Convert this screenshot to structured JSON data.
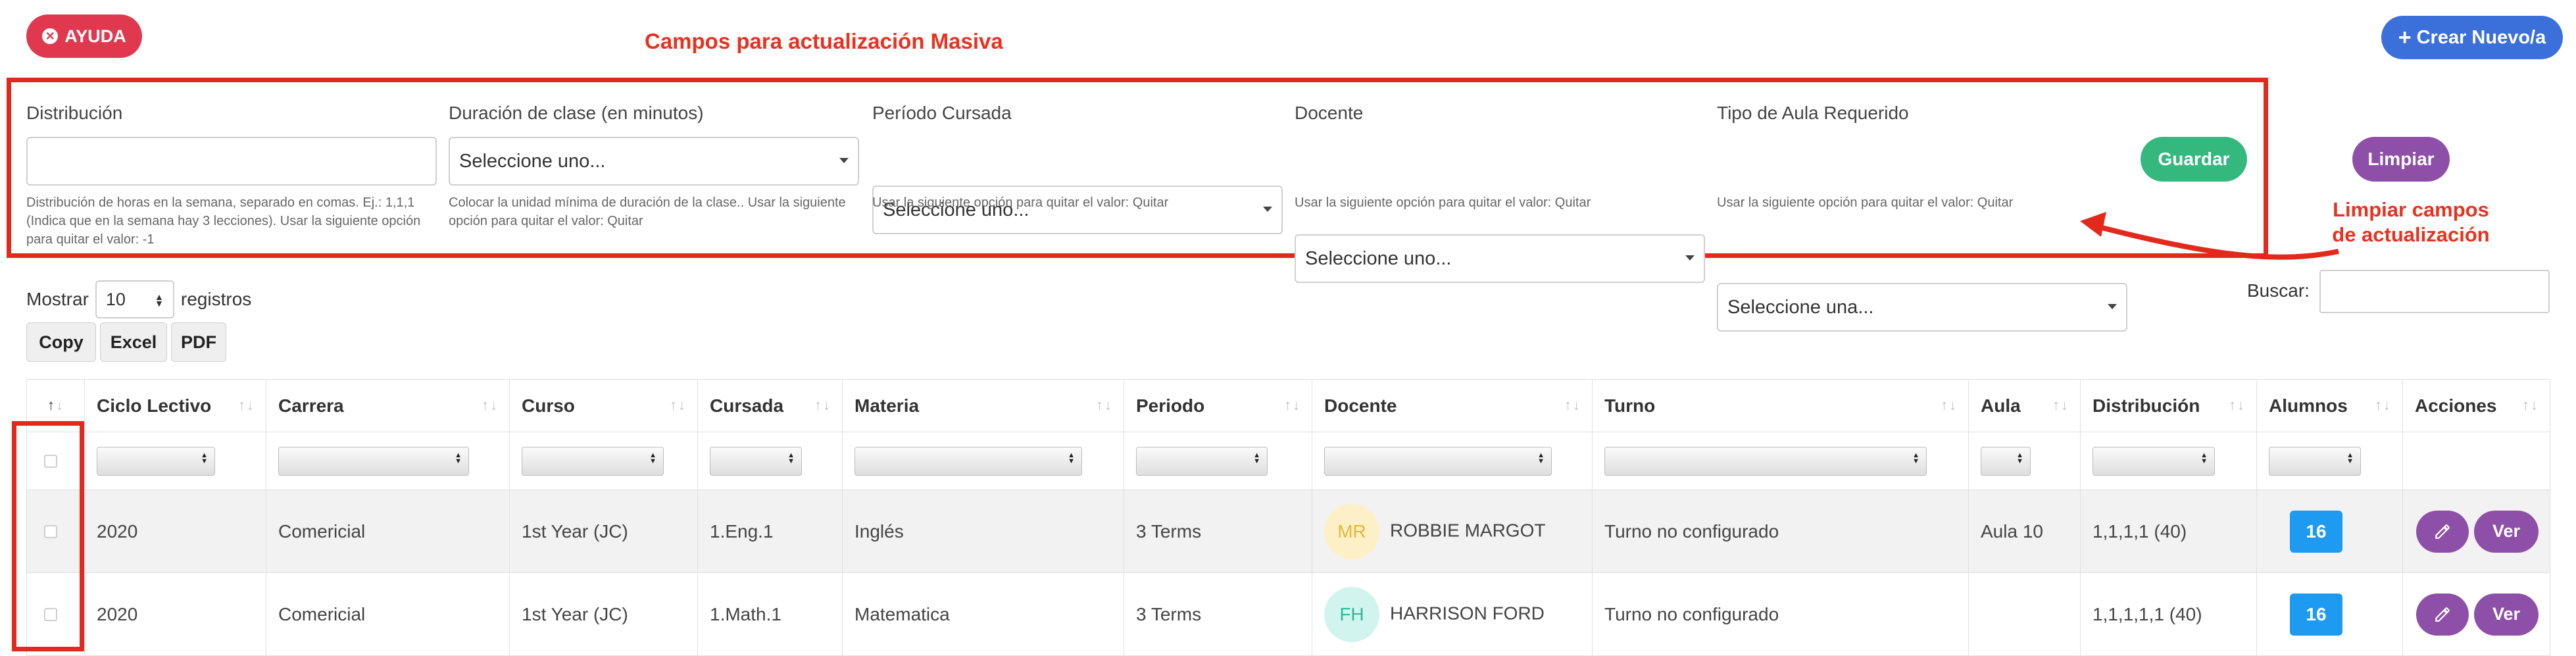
{
  "header": {
    "help_label": "AYUDA",
    "section_title": "Campos para actualización Masiva",
    "create_label": "Crear Nuevo/a"
  },
  "massUpdate": {
    "fields": [
      {
        "label": "Distribución",
        "value": "",
        "help": "Distribución de horas en la semana, separado en comas. Ej.: 1,1,1 (Indica que en la semana hay 3 lecciones). Usar la siguiente opción para quitar el valor: -1"
      },
      {
        "label": "Duración de clase (en minutos)",
        "value": "Seleccione uno...",
        "help": "Colocar la unidad mínima de duración de la clase.. Usar la siguiente opción para quitar el valor: Quitar"
      },
      {
        "label": "Período Cursada",
        "value": "Seleccione uno...",
        "help": "Usar la siguiente opción para quitar el valor: Quitar"
      },
      {
        "label": "Docente",
        "value": "Seleccione uno...",
        "help": "Usar la siguiente opción para quitar el valor: Quitar"
      },
      {
        "label": "Tipo de Aula Requerido",
        "value": "Seleccione una...",
        "help": "Usar la siguiente opción para quitar el valor: Quitar"
      }
    ],
    "save_label": "Guardar",
    "clear_label": "Limpiar",
    "clear_annotation": "Limpiar campos de actualización"
  },
  "table": {
    "show_label": "Mostrar",
    "page_length": "10",
    "records_label": "registros",
    "search_label": "Buscar:",
    "search_value": "",
    "export_buttons": [
      "Copy",
      "Excel",
      "PDF"
    ],
    "columns": [
      "",
      "Ciclo Lectivo",
      "Carrera",
      "Curso",
      "Cursada",
      "Materia",
      "Periodo",
      "Docente",
      "Turno",
      "Aula",
      "Distribución",
      "Alumnos",
      "Acciones"
    ],
    "rows": [
      {
        "ciclo": "2020",
        "carrera": "Comericial",
        "curso": "1st Year (JC)",
        "cursada": "1.Eng.1",
        "materia": "Inglés",
        "periodo": "3 Terms",
        "avatar_initials": "MR",
        "avatar_bg": "#fdf0c6",
        "avatar_fg": "#e8b73a",
        "docente": "ROBBIE MARGOT",
        "turno": "Turno no configurado",
        "aula": "Aula 10",
        "distribucion": "1,1,1,1 (40)",
        "alumnos": "16",
        "ver": "Ver"
      },
      {
        "ciclo": "2020",
        "carrera": "Comericial",
        "curso": "1st Year (JC)",
        "cursada": "1.Math.1",
        "materia": "Matematica",
        "periodo": "3 Terms",
        "avatar_initials": "FH",
        "avatar_bg": "#d2f4ee",
        "avatar_fg": "#2fb89c",
        "docente": "HARRISON FORD",
        "turno": "Turno no configurado",
        "aula": "",
        "distribucion": "1,1,1,1,1 (40)",
        "alumnos": "16",
        "ver": "Ver"
      }
    ]
  },
  "colors": {
    "annotation_red": "#e3291c",
    "help_button": "#e0394f",
    "create_button": "#3b6fd9",
    "save_button": "#35b87e",
    "purple": "#8e4fa8",
    "badge_blue": "#1e9af0"
  }
}
